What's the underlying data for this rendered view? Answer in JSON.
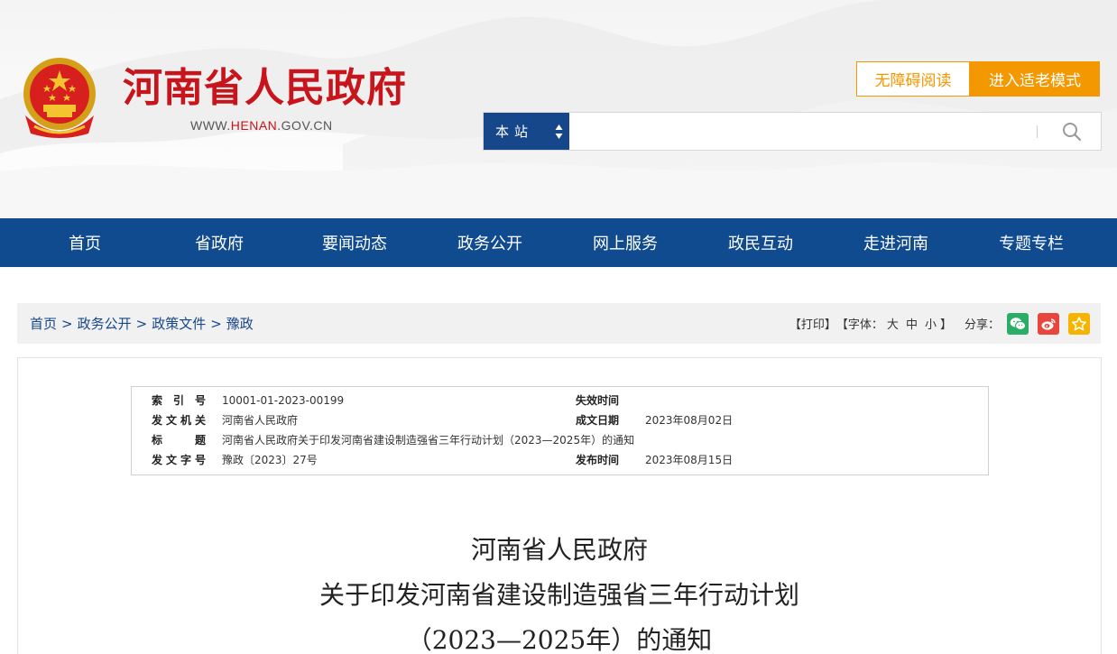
{
  "header": {
    "site_title": "河南省人民政府",
    "site_url_prefix": "WWW.",
    "site_url_highlight": "HENAN",
    "site_url_suffix": ".GOV.CN",
    "accessibility_label": "无障碍阅读",
    "elder_mode_label": "进入适老模式",
    "search": {
      "scope": "本站",
      "placeholder": ""
    },
    "colors": {
      "brand_red": "#c8141b",
      "accent_orange": "#f39800",
      "nav_blue": "#104b90"
    }
  },
  "nav": {
    "items": [
      {
        "label": "首页"
      },
      {
        "label": "省政府"
      },
      {
        "label": "要闻动态"
      },
      {
        "label": "政务公开"
      },
      {
        "label": "网上服务"
      },
      {
        "label": "政民互动"
      },
      {
        "label": "走进河南"
      },
      {
        "label": "专题专栏"
      }
    ]
  },
  "breadcrumb": {
    "items": [
      "首页",
      "政务公开",
      "政策文件",
      "豫政"
    ],
    "separator": ">"
  },
  "tools": {
    "print": "【打印】",
    "font_prefix": "【字体：",
    "font_large": "大",
    "font_medium": "中",
    "font_small": "小",
    "font_suffix": "】",
    "share_label": "分享：",
    "share_icons": [
      "wechat-icon",
      "weibo-icon",
      "favorite-icon"
    ]
  },
  "meta": {
    "index_label": "索引号",
    "index_value": "10001-01-2023-00199",
    "expire_label": "失效时间",
    "expire_value": "",
    "issuer_label": "发文机关",
    "issuer_value": "河南省人民政府",
    "written_label": "成文日期",
    "written_value": "2023年08月02日",
    "title_label": "标题",
    "title_value": "河南省人民政府关于印发河南省建设制造强省三年行动计划（2023—2025年）的通知",
    "docno_label": "发文字号",
    "docno_value": "豫政〔2023〕27号",
    "publish_label": "发布时间",
    "publish_value": "2023年08月15日"
  },
  "document": {
    "title_line1": "河南省人民政府",
    "title_line2": "关于印发河南省建设制造强省三年行动计划",
    "title_line3": "（2023—2025年）的通知"
  }
}
